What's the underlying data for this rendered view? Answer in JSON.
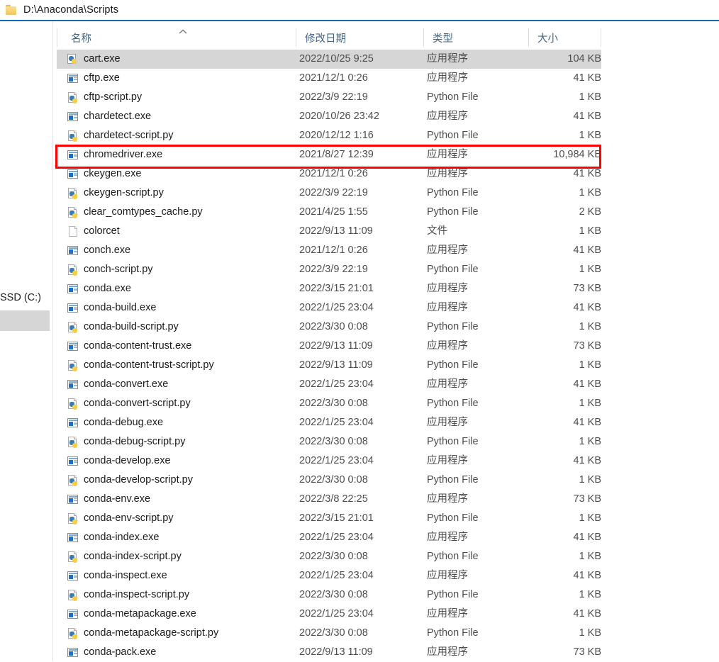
{
  "addressbar": {
    "folder_icon": "folder-icon",
    "path": "D:\\Anaconda\\Scripts"
  },
  "navpane": {
    "drive_label": "SSD (C:)"
  },
  "columns": {
    "name": "名称",
    "date": "修改日期",
    "type": "类型",
    "size": "大小",
    "sort_indicator": "chevron-up-icon"
  },
  "highlight": {
    "color": "#fd0000",
    "target_row": "chromedriver.exe"
  },
  "rows": [
    {
      "icon": "pyapp",
      "name": "cart.exe",
      "date": "2022/10/25 9:25",
      "type": "应用程序",
      "size": "104 KB",
      "selected": true
    },
    {
      "icon": "exe",
      "name": "cftp.exe",
      "date": "2021/12/1 0:26",
      "type": "应用程序",
      "size": "41 KB",
      "selected": false
    },
    {
      "icon": "py",
      "name": "cftp-script.py",
      "date": "2022/3/9 22:19",
      "type": "Python File",
      "size": "1 KB",
      "selected": false
    },
    {
      "icon": "exe",
      "name": "chardetect.exe",
      "date": "2020/10/26 23:42",
      "type": "应用程序",
      "size": "41 KB",
      "selected": false
    },
    {
      "icon": "py",
      "name": "chardetect-script.py",
      "date": "2020/12/12 1:16",
      "type": "Python File",
      "size": "1 KB",
      "selected": false
    },
    {
      "icon": "exe",
      "name": "chromedriver.exe",
      "date": "2021/8/27 12:39",
      "type": "应用程序",
      "size": "10,984 KB",
      "selected": false
    },
    {
      "icon": "exe",
      "name": "ckeygen.exe",
      "date": "2021/12/1 0:26",
      "type": "应用程序",
      "size": "41 KB",
      "selected": false
    },
    {
      "icon": "py",
      "name": "ckeygen-script.py",
      "date": "2022/3/9 22:19",
      "type": "Python File",
      "size": "1 KB",
      "selected": false
    },
    {
      "icon": "py",
      "name": "clear_comtypes_cache.py",
      "date": "2021/4/25 1:55",
      "type": "Python File",
      "size": "2 KB",
      "selected": false
    },
    {
      "icon": "file",
      "name": "colorcet",
      "date": "2022/9/13 11:09",
      "type": "文件",
      "size": "1 KB",
      "selected": false
    },
    {
      "icon": "exe",
      "name": "conch.exe",
      "date": "2021/12/1 0:26",
      "type": "应用程序",
      "size": "41 KB",
      "selected": false
    },
    {
      "icon": "py",
      "name": "conch-script.py",
      "date": "2022/3/9 22:19",
      "type": "Python File",
      "size": "1 KB",
      "selected": false
    },
    {
      "icon": "exe",
      "name": "conda.exe",
      "date": "2022/3/15 21:01",
      "type": "应用程序",
      "size": "73 KB",
      "selected": false
    },
    {
      "icon": "exe",
      "name": "conda-build.exe",
      "date": "2022/1/25 23:04",
      "type": "应用程序",
      "size": "41 KB",
      "selected": false
    },
    {
      "icon": "py",
      "name": "conda-build-script.py",
      "date": "2022/3/30 0:08",
      "type": "Python File",
      "size": "1 KB",
      "selected": false
    },
    {
      "icon": "exe",
      "name": "conda-content-trust.exe",
      "date": "2022/9/13 11:09",
      "type": "应用程序",
      "size": "73 KB",
      "selected": false
    },
    {
      "icon": "py",
      "name": "conda-content-trust-script.py",
      "date": "2022/9/13 11:09",
      "type": "Python File",
      "size": "1 KB",
      "selected": false
    },
    {
      "icon": "exe",
      "name": "conda-convert.exe",
      "date": "2022/1/25 23:04",
      "type": "应用程序",
      "size": "41 KB",
      "selected": false
    },
    {
      "icon": "py",
      "name": "conda-convert-script.py",
      "date": "2022/3/30 0:08",
      "type": "Python File",
      "size": "1 KB",
      "selected": false
    },
    {
      "icon": "exe",
      "name": "conda-debug.exe",
      "date": "2022/1/25 23:04",
      "type": "应用程序",
      "size": "41 KB",
      "selected": false
    },
    {
      "icon": "py",
      "name": "conda-debug-script.py",
      "date": "2022/3/30 0:08",
      "type": "Python File",
      "size": "1 KB",
      "selected": false
    },
    {
      "icon": "exe",
      "name": "conda-develop.exe",
      "date": "2022/1/25 23:04",
      "type": "应用程序",
      "size": "41 KB",
      "selected": false
    },
    {
      "icon": "py",
      "name": "conda-develop-script.py",
      "date": "2022/3/30 0:08",
      "type": "Python File",
      "size": "1 KB",
      "selected": false
    },
    {
      "icon": "exe",
      "name": "conda-env.exe",
      "date": "2022/3/8 22:25",
      "type": "应用程序",
      "size": "73 KB",
      "selected": false
    },
    {
      "icon": "py",
      "name": "conda-env-script.py",
      "date": "2022/3/15 21:01",
      "type": "Python File",
      "size": "1 KB",
      "selected": false
    },
    {
      "icon": "exe",
      "name": "conda-index.exe",
      "date": "2022/1/25 23:04",
      "type": "应用程序",
      "size": "41 KB",
      "selected": false
    },
    {
      "icon": "py",
      "name": "conda-index-script.py",
      "date": "2022/3/30 0:08",
      "type": "Python File",
      "size": "1 KB",
      "selected": false
    },
    {
      "icon": "exe",
      "name": "conda-inspect.exe",
      "date": "2022/1/25 23:04",
      "type": "应用程序",
      "size": "41 KB",
      "selected": false
    },
    {
      "icon": "py",
      "name": "conda-inspect-script.py",
      "date": "2022/3/30 0:08",
      "type": "Python File",
      "size": "1 KB",
      "selected": false
    },
    {
      "icon": "exe",
      "name": "conda-metapackage.exe",
      "date": "2022/1/25 23:04",
      "type": "应用程序",
      "size": "41 KB",
      "selected": false
    },
    {
      "icon": "py",
      "name": "conda-metapackage-script.py",
      "date": "2022/3/30 0:08",
      "type": "Python File",
      "size": "1 KB",
      "selected": false
    },
    {
      "icon": "exe",
      "name": "conda-pack.exe",
      "date": "2022/9/13 11:09",
      "type": "应用程序",
      "size": "73 KB",
      "selected": false
    }
  ]
}
